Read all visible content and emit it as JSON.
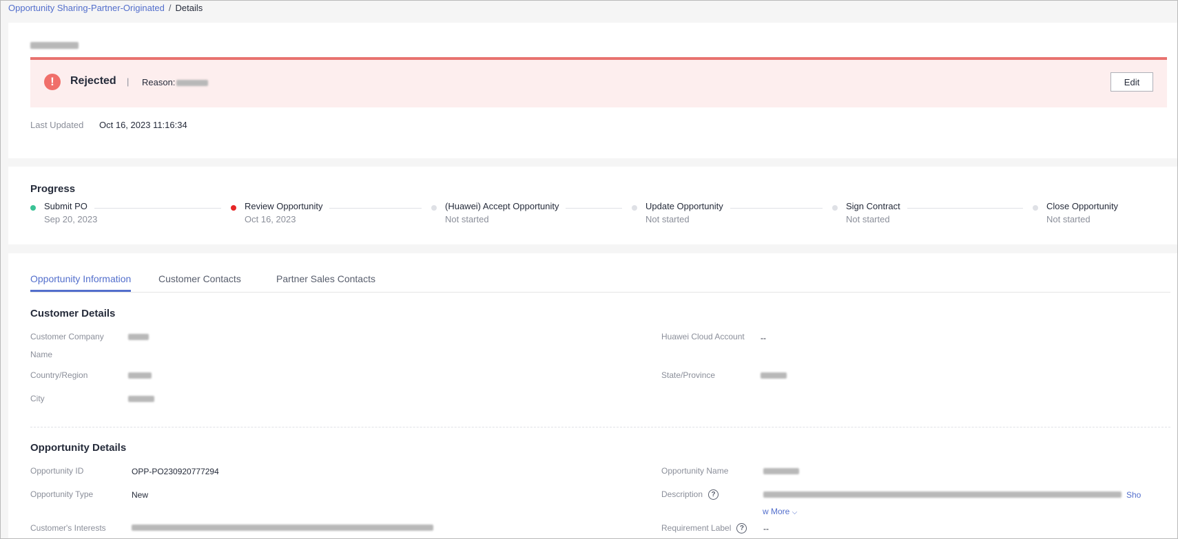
{
  "breadcrumb": {
    "link": "Opportunity Sharing-Partner-Originated",
    "separator": "/",
    "current": "Details"
  },
  "status": {
    "icon": "exclamation-icon",
    "text": "Rejected",
    "separator": "|",
    "reason_label": "Reason:",
    "edit_label": "Edit",
    "colors": {
      "bar_bg": "#fdeeee",
      "bar_border": "#e8726f",
      "icon_bg": "#f06f6a"
    }
  },
  "last_updated": {
    "label": "Last Updated",
    "value": "Oct 16, 2023 11:16:34"
  },
  "progress": {
    "title": "Progress",
    "steps": [
      {
        "name": "Submit PO",
        "sub": "Sep 20, 2023",
        "state": "done"
      },
      {
        "name": "Review Opportunity",
        "sub": "Oct 16, 2023",
        "state": "current"
      },
      {
        "name": "(Huawei) Accept Opportunity",
        "sub": "Not started",
        "state": "pending"
      },
      {
        "name": "Update Opportunity",
        "sub": "Not started",
        "state": "pending"
      },
      {
        "name": "Sign Contract",
        "sub": "Not started",
        "state": "pending"
      },
      {
        "name": "Close Opportunity",
        "sub": "Not started",
        "state": "pending"
      }
    ]
  },
  "tabs": [
    "Opportunity Information",
    "Customer Contacts",
    "Partner Sales Contacts"
  ],
  "customer_details": {
    "title": "Customer Details",
    "company_label_1": "Customer Company",
    "company_label_2": "Name",
    "cloud_account_label": "Huawei Cloud Account",
    "cloud_account_value": "--",
    "country_label": "Country/Region",
    "state_label": "State/Province",
    "city_label": "City"
  },
  "opportunity_details": {
    "title": "Opportunity Details",
    "id_label": "Opportunity ID",
    "id_value": "OPP-PO230920777294",
    "name_label": "Opportunity Name",
    "type_label": "Opportunity Type",
    "type_value": "New",
    "description_label": "Description",
    "show_more_1": "Sho",
    "show_more_2": "w More",
    "interests_label": "Customer's Interests",
    "requirement_label": "Requirement Label",
    "requirement_value": "--"
  },
  "accent_color": "#526ecc"
}
